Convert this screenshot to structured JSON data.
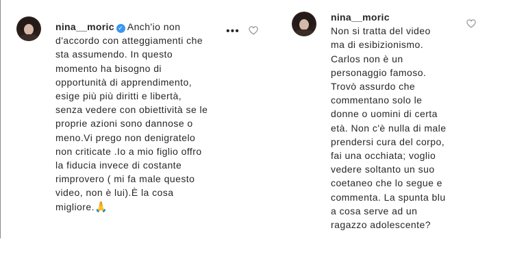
{
  "comments": [
    {
      "username": "nina__moric",
      "verified": true,
      "text": "Anch'io non\nd'accordo con atteggiamenti che\nsta assumendo. In questo\nmomento ha bisogno di\nopportunità di apprendimento,\nesige più più diritti e libertà,\nsenza vedere con obiettività se le\nproprie azioni sono dannose o\nmeno.Vi prego non denigratelo\nnon criticate .Io a mio figlio offro\nla fiducia invece di costante\nrimprovero ( mi fa male questo\nvideo, non è lui).È la cosa\nmigliore.",
      "emoji": "🙏",
      "more_glyph": "•••",
      "icons": [
        "avatar",
        "verified-icon",
        "more-icon",
        "heart-icon",
        "praying-hands-icon"
      ]
    },
    {
      "username": "nina__moric",
      "verified": false,
      "text": "Non si tratta del video\nma di esibizionismo.\nCarlos non è un\npersonaggio famoso.\nTrovò assurdo che\ncommentano solo le\ndonne o uomini di certa\netà. Non c'è nulla di male\nprendersi cura del corpo,\nfai una occhiata; voglio\nvedere soltanto un suo\ncoetaneo che lo segue e\ncommenta. La spunta blu\na cosa serve ad un\nragazzo adolescente?",
      "icons": [
        "avatar",
        "heart-icon"
      ]
    }
  ],
  "colors": {
    "text": "#262626",
    "verified": "#3897f0",
    "background": "#ffffff"
  }
}
